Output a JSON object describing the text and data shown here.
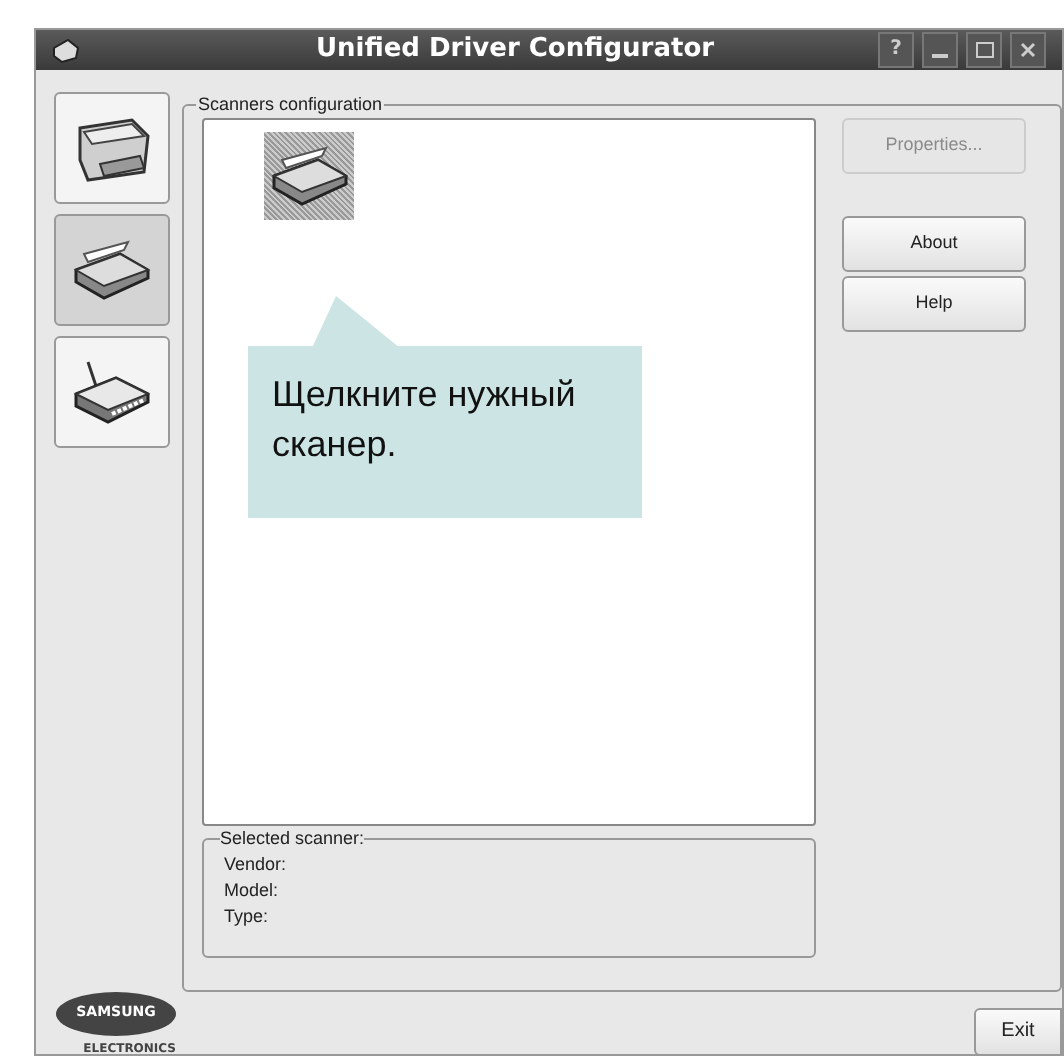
{
  "window": {
    "title": "Unified Driver Configurator",
    "help_button": "?"
  },
  "sidebar": {
    "items": [
      {
        "kind": "printer",
        "selected": false
      },
      {
        "kind": "scanner",
        "selected": true
      },
      {
        "kind": "port",
        "selected": false
      }
    ]
  },
  "scanners_group": {
    "title": "Scanners configuration",
    "scanners": [
      {
        "selected": true
      }
    ]
  },
  "callout": {
    "text": "Щелкните нужный сканер."
  },
  "buttons": [
    {
      "label": "Properties...",
      "disabled": true
    },
    {
      "label": "About",
      "disabled": false
    },
    {
      "label": "Help",
      "disabled": false
    }
  ],
  "selected_scanner": {
    "title": "Selected scanner:",
    "fields": [
      "Vendor:",
      "Model:",
      "Type:"
    ]
  },
  "logo": {
    "brand": "SAMSUNG",
    "subtitle": "ELECTRONICS"
  },
  "exit_button": "Exit"
}
